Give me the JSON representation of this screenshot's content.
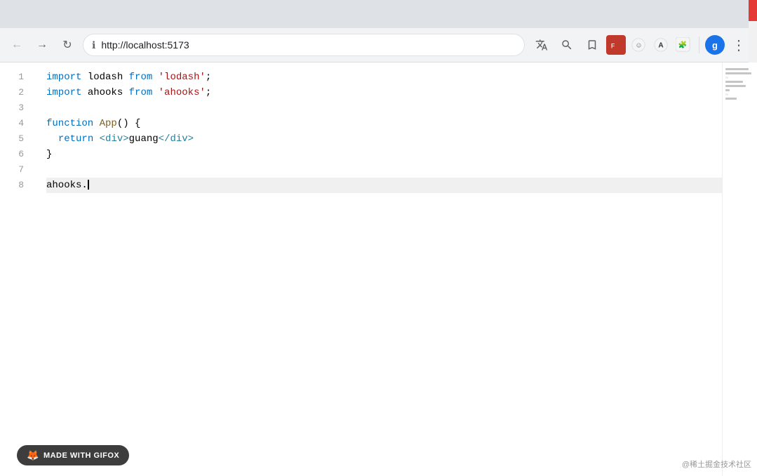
{
  "browser": {
    "url": "http://localhost:5173",
    "back_label": "←",
    "forward_label": "→",
    "reload_label": "↻",
    "info_icon": "ℹ",
    "translate_icon": "🌐",
    "zoom_icon": "🔍",
    "bookmark_icon": "☆",
    "avatar_label": "g",
    "menu_label": "⋮",
    "extension_icons": [
      "🦊",
      "☺",
      "A",
      "🧩"
    ]
  },
  "editor": {
    "lines": [
      {
        "num": "1",
        "tokens": [
          {
            "t": "kw",
            "v": "import"
          },
          {
            "t": "plain",
            "v": " lodash "
          },
          {
            "t": "kw",
            "v": "from"
          },
          {
            "t": "plain",
            "v": " "
          },
          {
            "t": "str",
            "v": "'lodash'"
          },
          {
            "t": "plain",
            "v": ";"
          }
        ]
      },
      {
        "num": "2",
        "tokens": [
          {
            "t": "kw",
            "v": "import"
          },
          {
            "t": "plain",
            "v": " ahooks "
          },
          {
            "t": "kw",
            "v": "from"
          },
          {
            "t": "plain",
            "v": " "
          },
          {
            "t": "str",
            "v": "'ahooks'"
          },
          {
            "t": "plain",
            "v": ";"
          }
        ]
      },
      {
        "num": "3",
        "tokens": []
      },
      {
        "num": "4",
        "tokens": [
          {
            "t": "kw",
            "v": "function"
          },
          {
            "t": "plain",
            "v": " "
          },
          {
            "t": "fn",
            "v": "App"
          },
          {
            "t": "plain",
            "v": "() {"
          }
        ]
      },
      {
        "num": "5",
        "tokens": [
          {
            "t": "plain",
            "v": "  "
          },
          {
            "t": "kw",
            "v": "return"
          },
          {
            "t": "plain",
            "v": " "
          },
          {
            "t": "jsx",
            "v": "<div>"
          },
          {
            "t": "plain",
            "v": "guang"
          },
          {
            "t": "jsx",
            "v": "</div>"
          }
        ]
      },
      {
        "num": "6",
        "tokens": [
          {
            "t": "plain",
            "v": "}"
          }
        ]
      },
      {
        "num": "7",
        "tokens": []
      },
      {
        "num": "8",
        "tokens": [
          {
            "t": "plain",
            "v": "ahooks."
          }
        ],
        "cursor": true,
        "active": true
      }
    ]
  },
  "badge": {
    "label": "MADE WITH GIFOX"
  },
  "watermark": {
    "text": "@稀土掘金技术社区"
  },
  "minimap": {
    "label": "minimap"
  }
}
